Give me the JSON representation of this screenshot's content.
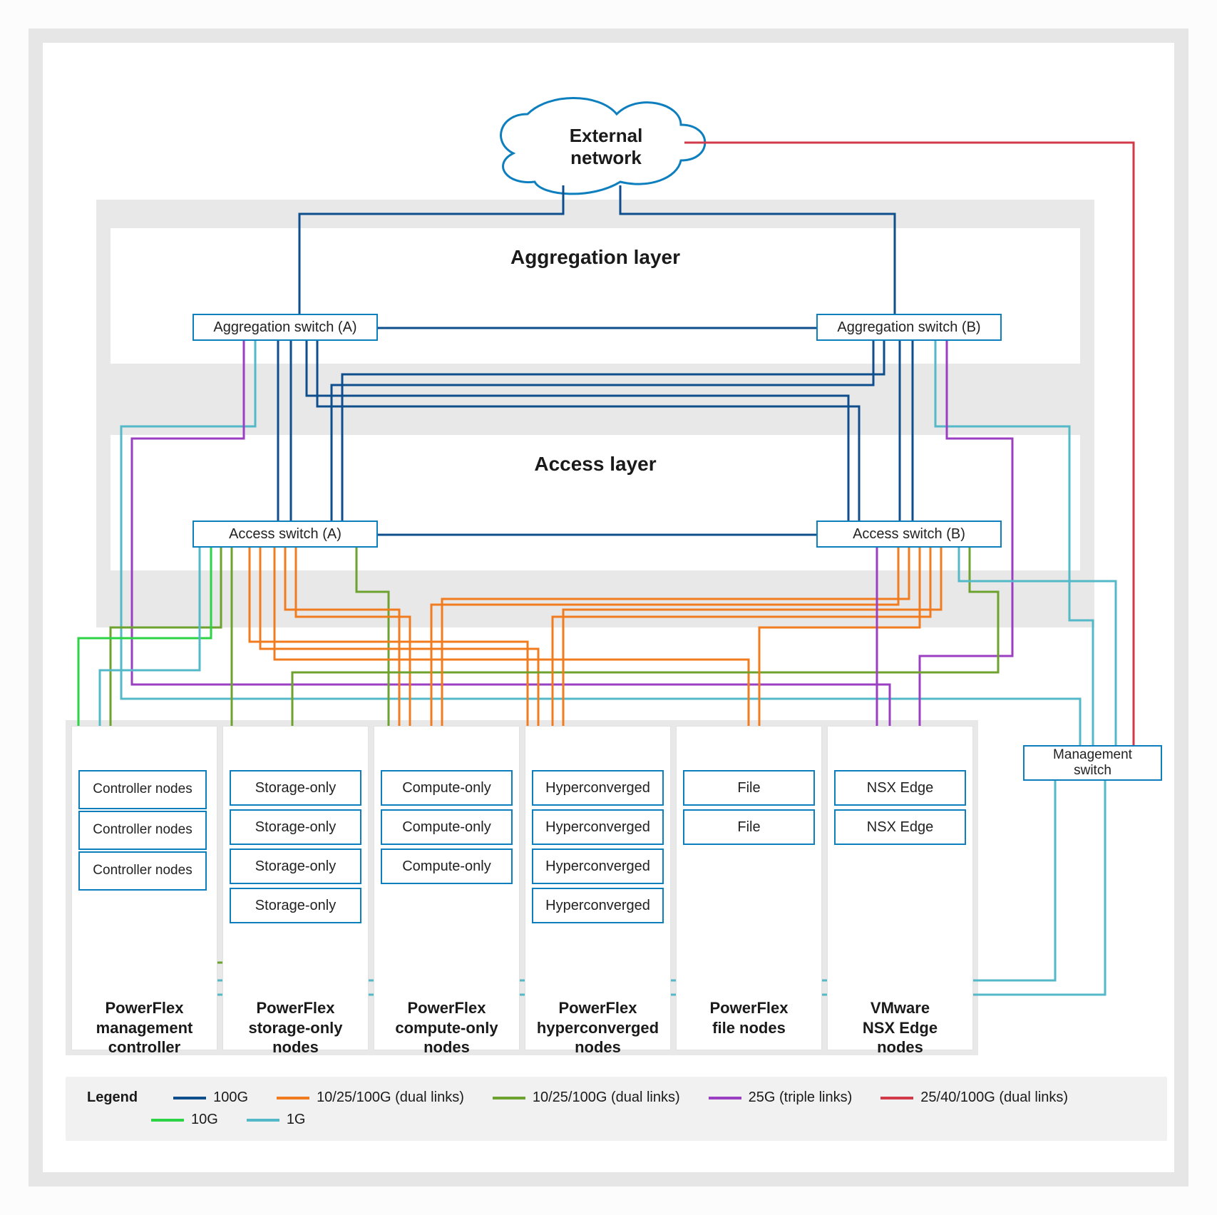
{
  "cloud": {
    "label_line1": "External",
    "label_line2": "network"
  },
  "layers": {
    "agg": {
      "title": "Aggregation layer",
      "switchA": "Aggregation switch (A)",
      "switchB": "Aggregation switch (B)"
    },
    "acc": {
      "title": "Access layer",
      "switchA": "Access switch (A)",
      "switchB": "Access switch (B)"
    }
  },
  "mgmt_switch": {
    "label_line1": "Management",
    "label_line2": "switch"
  },
  "columns": [
    {
      "label_line1": "PowerFlex",
      "label_line2": "management",
      "label_line3": "controller",
      "nodes": [
        "Controller nodes",
        "Controller nodes",
        "Controller nodes"
      ]
    },
    {
      "label_line1": "PowerFlex",
      "label_line2": "storage-only",
      "label_line3": "nodes",
      "nodes": [
        "Storage-only",
        "Storage-only",
        "Storage-only",
        "Storage-only"
      ]
    },
    {
      "label_line1": "PowerFlex",
      "label_line2": "compute-only",
      "label_line3": "nodes",
      "nodes": [
        "Compute-only",
        "Compute-only",
        "Compute-only"
      ]
    },
    {
      "label_line1": "PowerFlex",
      "label_line2": "hyperconverged",
      "label_line3": "nodes",
      "nodes": [
        "Hyperconverged",
        "Hyperconverged",
        "Hyperconverged",
        "Hyperconverged"
      ]
    },
    {
      "label_line1": "PowerFlex",
      "label_line2": "file nodes",
      "label_line3": "",
      "nodes": [
        "File",
        "File"
      ]
    },
    {
      "label_line1": "VMware",
      "label_line2": "NSX Edge",
      "label_line3": "nodes",
      "nodes": [
        "NSX Edge",
        "NSX Edge"
      ]
    }
  ],
  "legend": {
    "title": "Legend",
    "items": [
      {
        "color": "#0e4e8c",
        "label": "100G"
      },
      {
        "color": "#f07c1f",
        "label": "10/25/100G (dual links)"
      },
      {
        "color": "#6da22e",
        "label": "10/25/100G (dual links)"
      },
      {
        "color": "#9b3fc2",
        "label": "25G (triple links)"
      },
      {
        "color": "#d23a4a",
        "label": "25/40/100G (dual links)"
      },
      {
        "color": "#2bd345",
        "label": "10G"
      },
      {
        "color": "#53b9c9",
        "label": "1G"
      }
    ]
  },
  "colors": {
    "c100g": "#0e4e8c",
    "cOrange": "#f07c1f",
    "cOlive": "#6da22e",
    "cPurple": "#9b3fc2",
    "cRed": "#d23a4a",
    "cGreen": "#2bd345",
    "cTeal": "#53b9c9",
    "boxBorder": "#0d7fbf"
  }
}
